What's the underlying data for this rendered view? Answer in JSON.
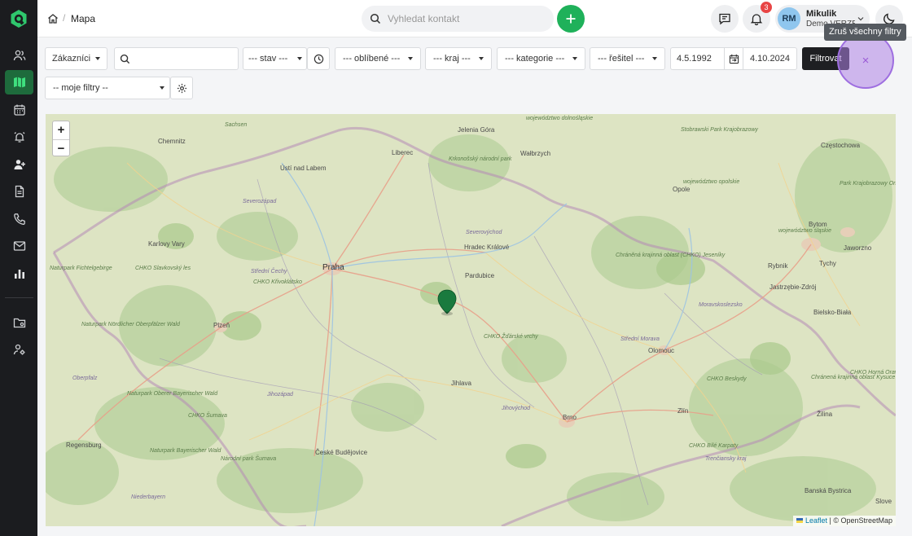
{
  "breadcrumb": {
    "title": "Mapa"
  },
  "header": {
    "search_placeholder": "Vyhledat kontakt",
    "notifications_count": "3",
    "user": {
      "initials": "RM",
      "name": "Mikulik",
      "org": "Demo VERZE"
    },
    "tooltip": "Zruš všechny filtry"
  },
  "filters": {
    "type": "Zákazníci",
    "search_value": "",
    "stav": "--- stav ---",
    "oblibene": "--- oblíbené ---",
    "kraj": "--- kraj ---",
    "kategorie": "--- kategorie ---",
    "resitel": "--- řešitel ---",
    "date_from": "4.5.1992",
    "date_to": "4.10.2024",
    "filter_label": "Filtrovat",
    "clear_label": "×",
    "my_filters": "-- moje filtry --"
  },
  "map": {
    "zoom_in": "+",
    "zoom_out": "−",
    "attribution_leaflet": "Leaflet",
    "attribution_rest": " | © OpenStreetMap",
    "cities": [
      {
        "name": "Praha",
        "big": true
      },
      {
        "name": "Jelenia Góra"
      },
      {
        "name": "Wałbrzych"
      },
      {
        "name": "Chemnitz"
      },
      {
        "name": "Liberec"
      },
      {
        "name": "Ústí nad Labem"
      },
      {
        "name": "Karlovy Vary"
      },
      {
        "name": "Hradec Králové"
      },
      {
        "name": "Pardubice"
      },
      {
        "name": "Plzeň"
      },
      {
        "name": "Jihlava"
      },
      {
        "name": "Brno"
      },
      {
        "name": "Olomouc"
      },
      {
        "name": "Zlín"
      },
      {
        "name": "České Budějovice"
      },
      {
        "name": "Regensburg"
      },
      {
        "name": "Opole"
      },
      {
        "name": "Bytom"
      },
      {
        "name": "Częstochowa"
      },
      {
        "name": "Jaworzno"
      },
      {
        "name": "Rybnik"
      },
      {
        "name": "Tychy"
      },
      {
        "name": "Jastrzębie-Zdrój"
      },
      {
        "name": "Bielsko-Biała"
      },
      {
        "name": "Žilina"
      },
      {
        "name": "Banská Bystrica"
      },
      {
        "name": "Slove"
      }
    ],
    "areas": [
      "Sachsen",
      "województwo dolnośląskie",
      "Krkonošský národní park",
      "Severozápad",
      "Severovýchod",
      "Střední Čechy",
      "CHKO Křivoklátsko",
      "CHKO Slavkovský les",
      "Naturpark Fichtelgebirge",
      "Naturpark Nördlicher Oberpfälzer Wald",
      "Oberpfalz",
      "Naturpark Oberer Bayerischer Wald",
      "CHKO Šumava",
      "Jihozápad",
      "Jihovýchod",
      "CHKO Žďárské vrchy",
      "Chráněná krajinná oblast (CHKO) Jeseníky",
      "Moravskoslezsko",
      "Střední Morava",
      "CHKO Beskydy",
      "CHKO Bílé Karpaty",
      "Trenčiansky kraj",
      "Naturpark Bayerischer Wald",
      "Národní park Šumava",
      "Niederbayern",
      "Stobrawski Park Krajobrazowy",
      "województwo opolskie",
      "województwo śląskie",
      "Chránená krajinná oblasť Kysuce",
      "CHKO Horná Orava",
      "Park Krajobrazowy Orlich Gniazd"
    ]
  },
  "colors": {
    "accent": "#1fb15a",
    "sidebar": "#1b1c1f",
    "active": "#1e6b3c",
    "marker": "#1a7a3e"
  }
}
